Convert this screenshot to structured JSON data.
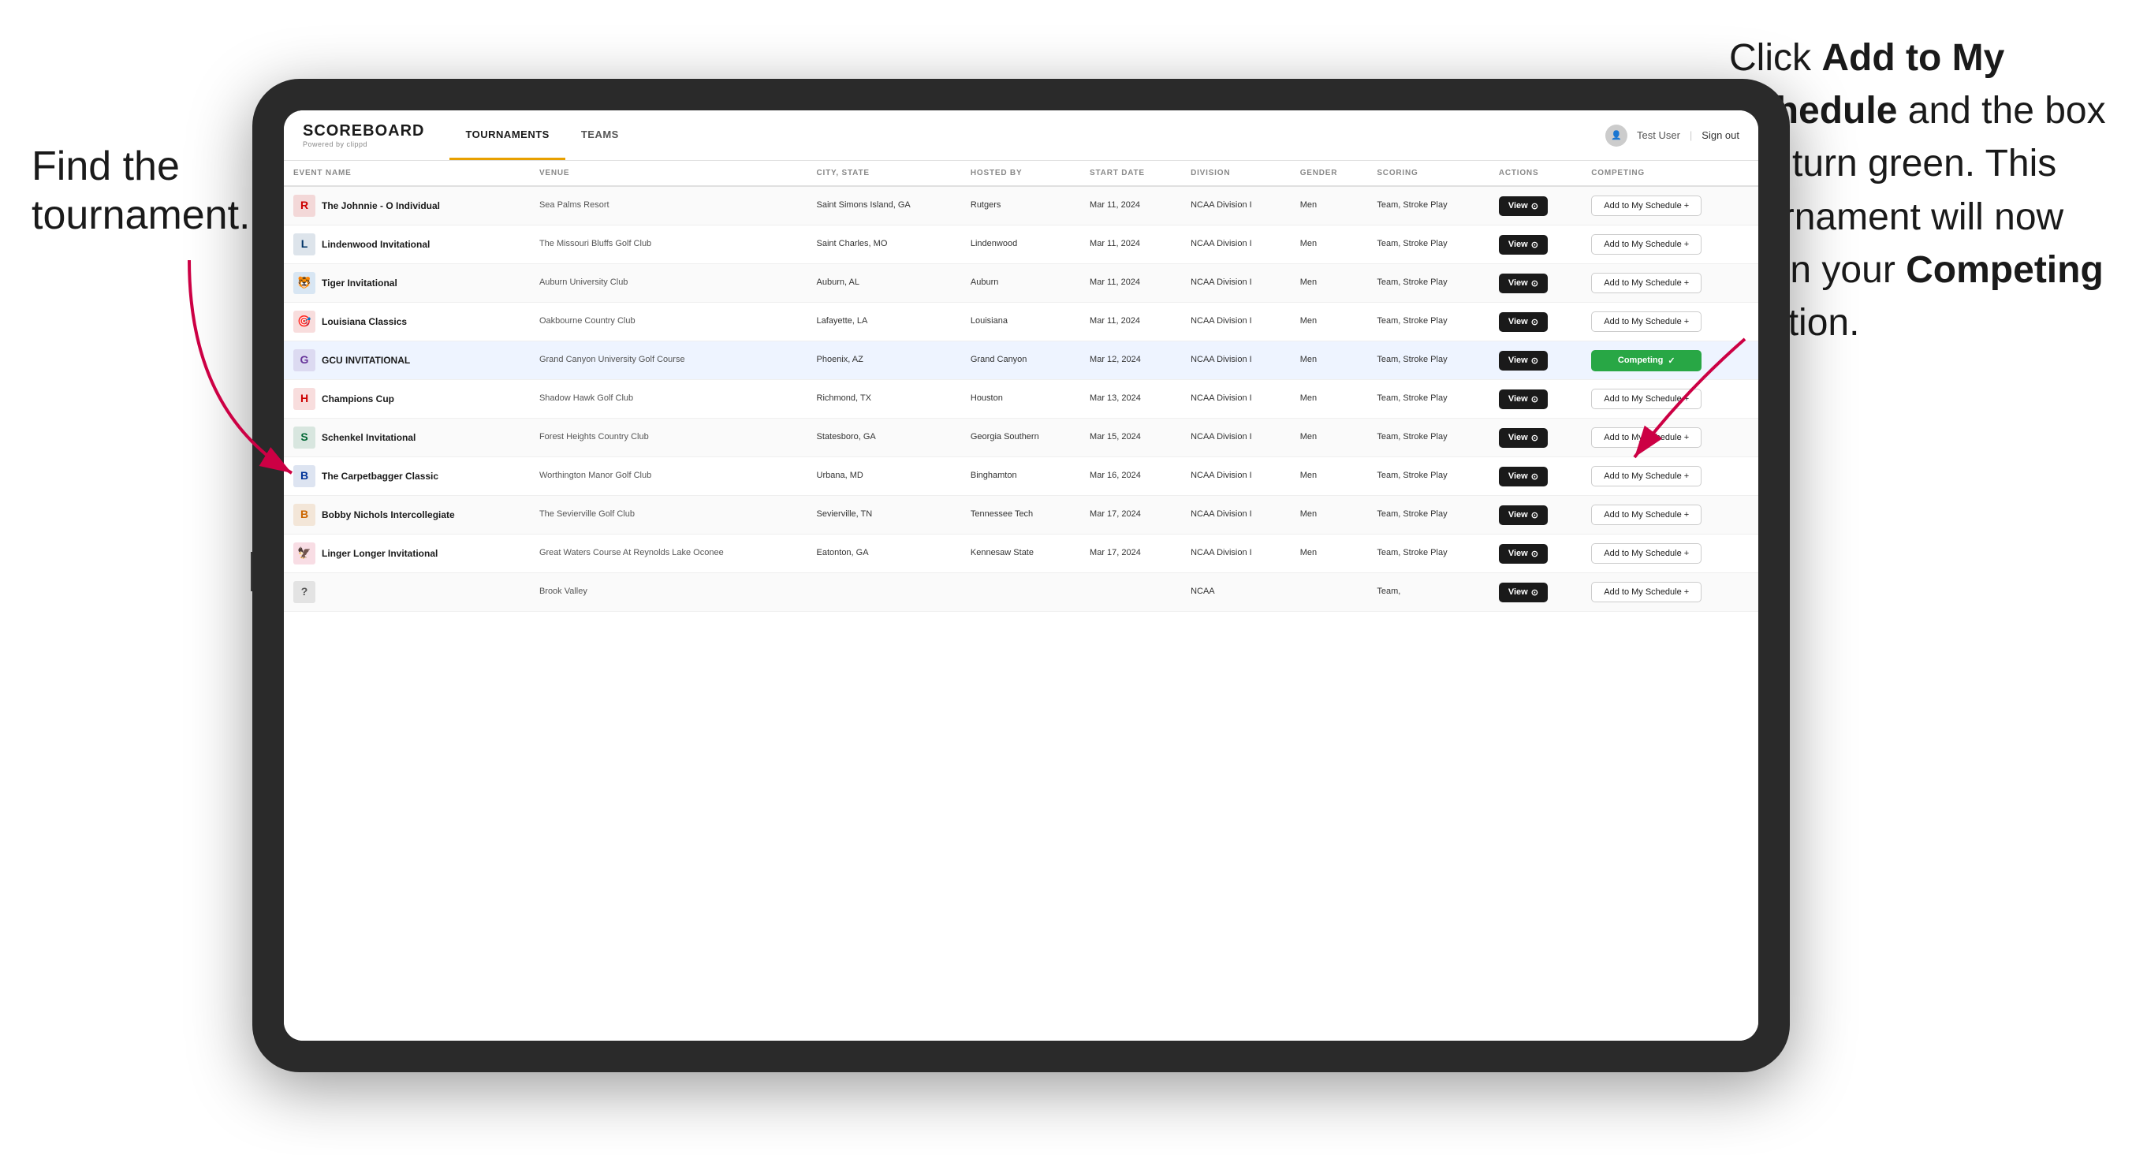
{
  "annotations": {
    "left_title": "Find the tournament.",
    "right_text_part1": "Click ",
    "right_bold1": "Add to My Schedule",
    "right_text_part2": " and the box will turn green. This tournament will now be in your ",
    "right_bold2": "Competing",
    "right_text_part3": " section."
  },
  "header": {
    "logo": "SCOREBOARD",
    "logo_sub": "Powered by clippd",
    "tabs": [
      {
        "label": "TOURNAMENTS",
        "active": true
      },
      {
        "label": "TEAMS",
        "active": false
      }
    ],
    "user": "Test User",
    "signout": "Sign out"
  },
  "table": {
    "columns": [
      "EVENT NAME",
      "VENUE",
      "CITY, STATE",
      "HOSTED BY",
      "START DATE",
      "DIVISION",
      "GENDER",
      "SCORING",
      "ACTIONS",
      "COMPETING"
    ],
    "rows": [
      {
        "logo_color": "#cc0000",
        "logo_text": "R",
        "event": "The Johnnie - O Individual",
        "venue": "Sea Palms Resort",
        "city": "Saint Simons Island, GA",
        "hosted": "Rutgers",
        "date": "Mar 11, 2024",
        "division": "NCAA Division I",
        "gender": "Men",
        "scoring": "Team, Stroke Play",
        "competing": false,
        "highlighted": false
      },
      {
        "logo_color": "#003366",
        "logo_text": "L",
        "event": "Lindenwood Invitational",
        "venue": "The Missouri Bluffs Golf Club",
        "city": "Saint Charles, MO",
        "hosted": "Lindenwood",
        "date": "Mar 11, 2024",
        "division": "NCAA Division I",
        "gender": "Men",
        "scoring": "Team, Stroke Play",
        "competing": false,
        "highlighted": false
      },
      {
        "logo_color": "#0066cc",
        "logo_text": "🐯",
        "event": "Tiger Invitational",
        "venue": "Auburn University Club",
        "city": "Auburn, AL",
        "hosted": "Auburn",
        "date": "Mar 11, 2024",
        "division": "NCAA Division I",
        "gender": "Men",
        "scoring": "Team, Stroke Play",
        "competing": false,
        "highlighted": false
      },
      {
        "logo_color": "#cc0000",
        "logo_text": "🎯",
        "event": "Louisiana Classics",
        "venue": "Oakbourne Country Club",
        "city": "Lafayette, LA",
        "hosted": "Louisiana",
        "date": "Mar 11, 2024",
        "division": "NCAA Division I",
        "gender": "Men",
        "scoring": "Team, Stroke Play",
        "competing": false,
        "highlighted": false
      },
      {
        "logo_color": "#663399",
        "logo_text": "G",
        "event": "GCU INVITATIONAL",
        "venue": "Grand Canyon University Golf Course",
        "city": "Phoenix, AZ",
        "hosted": "Grand Canyon",
        "date": "Mar 12, 2024",
        "division": "NCAA Division I",
        "gender": "Men",
        "scoring": "Team, Stroke Play",
        "competing": true,
        "highlighted": true
      },
      {
        "logo_color": "#cc0000",
        "logo_text": "H",
        "event": "Champions Cup",
        "venue": "Shadow Hawk Golf Club",
        "city": "Richmond, TX",
        "hosted": "Houston",
        "date": "Mar 13, 2024",
        "division": "NCAA Division I",
        "gender": "Men",
        "scoring": "Team, Stroke Play",
        "competing": false,
        "highlighted": false
      },
      {
        "logo_color": "#006633",
        "logo_text": "S",
        "event": "Schenkel Invitational",
        "venue": "Forest Heights Country Club",
        "city": "Statesboro, GA",
        "hosted": "Georgia Southern",
        "date": "Mar 15, 2024",
        "division": "NCAA Division I",
        "gender": "Men",
        "scoring": "Team, Stroke Play",
        "competing": false,
        "highlighted": false
      },
      {
        "logo_color": "#003399",
        "logo_text": "B",
        "event": "The Carpetbagger Classic",
        "venue": "Worthington Manor Golf Club",
        "city": "Urbana, MD",
        "hosted": "Binghamton",
        "date": "Mar 16, 2024",
        "division": "NCAA Division I",
        "gender": "Men",
        "scoring": "Team, Stroke Play",
        "competing": false,
        "highlighted": false
      },
      {
        "logo_color": "#cc6600",
        "logo_text": "B",
        "event": "Bobby Nichols Intercollegiate",
        "venue": "The Sevierville Golf Club",
        "city": "Sevierville, TN",
        "hosted": "Tennessee Tech",
        "date": "Mar 17, 2024",
        "division": "NCAA Division I",
        "gender": "Men",
        "scoring": "Team, Stroke Play",
        "competing": false,
        "highlighted": false
      },
      {
        "logo_color": "#cc0033",
        "logo_text": "🦅",
        "event": "Linger Longer Invitational",
        "venue": "Great Waters Course At Reynolds Lake Oconee",
        "city": "Eatonton, GA",
        "hosted": "Kennesaw State",
        "date": "Mar 17, 2024",
        "division": "NCAA Division I",
        "gender": "Men",
        "scoring": "Team, Stroke Play",
        "competing": false,
        "highlighted": false
      },
      {
        "logo_color": "#555555",
        "logo_text": "?",
        "event": "",
        "venue": "Brook Valley",
        "city": "",
        "hosted": "",
        "date": "",
        "division": "NCAA",
        "gender": "",
        "scoring": "Team,",
        "competing": false,
        "highlighted": false
      }
    ],
    "view_label": "View",
    "add_label": "Add to My Schedule +",
    "competing_label": "Competing ✓"
  }
}
